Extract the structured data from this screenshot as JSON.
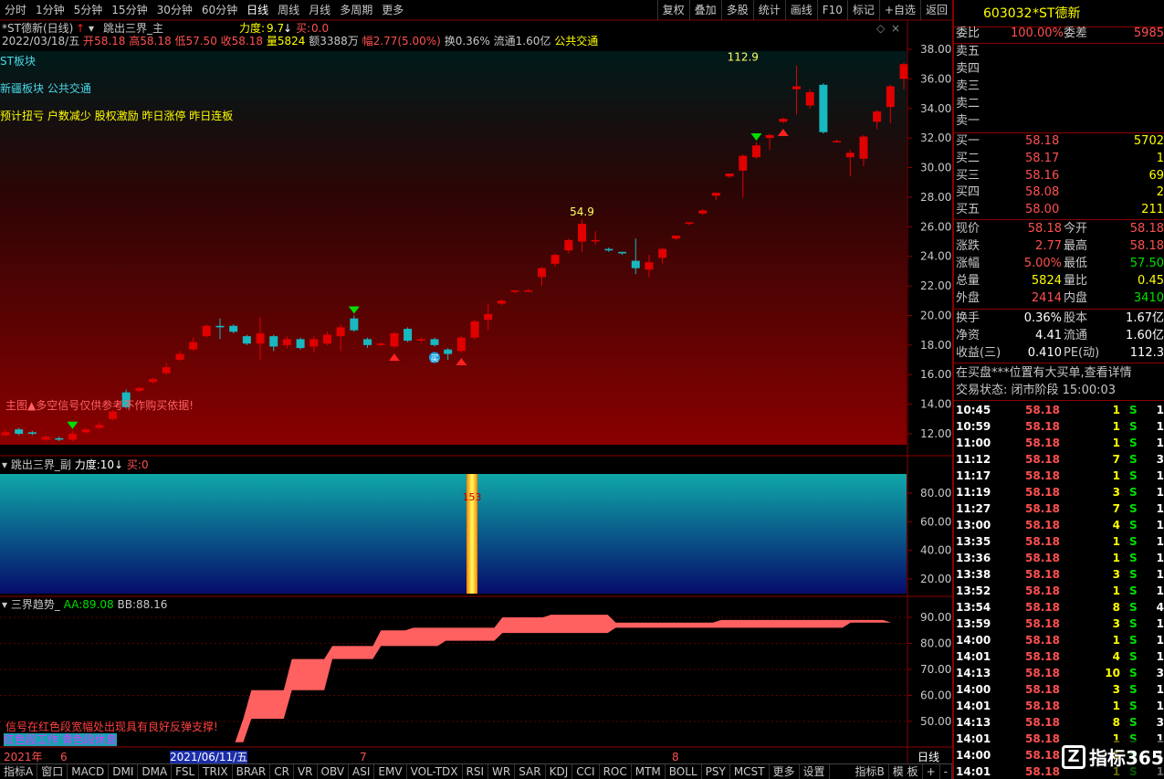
{
  "toolbar": {
    "periods": [
      "分时",
      "1分钟",
      "5分钟",
      "15分钟",
      "30分钟",
      "60分钟",
      "日线",
      "周线",
      "月线",
      "多周期",
      "更多"
    ],
    "active_period": "日线",
    "right": [
      "复权",
      "叠加",
      "多股",
      "统计",
      "画线",
      "F10",
      "标记",
      "+自选",
      "返回"
    ]
  },
  "main_panel": {
    "title": "*ST德新(日线)",
    "indicator": "跳出三界_主",
    "force_label": "力度:",
    "force_value": "9.7",
    "buy_label": "买:",
    "buy_value": "0.0",
    "quote_date": "2022/03/18/五",
    "open_label": "开",
    "open": "58.18",
    "high_label": "高",
    "high": "58.18",
    "low_label": "低",
    "low": "57.50",
    "close_label": "收",
    "close": "58.18",
    "vol_label": "量",
    "vol": "5824",
    "amt_label": "额",
    "amt": "3388万",
    "chg_label": "幅",
    "chg": "2.77(5.00%)",
    "turn_label": "换",
    "turn": "0.36%",
    "float_label": "流通",
    "float": "1.60亿",
    "concept": "公共交通",
    "st_tag": "ST板块",
    "sector_tags": "新疆板块  公共交通",
    "event_tags": "预计扭亏 户数减少 股权激励 昨日涨停 昨日连板",
    "warning": "主图▲多空信号仅供参考不作购买依据!",
    "peak_label_1": "112.9",
    "peak_label_2": "54.9",
    "buy_marker": "买",
    "y_ticks": [
      "38.00",
      "36.00",
      "34.00",
      "32.00",
      "30.00",
      "28.00",
      "26.00",
      "24.00",
      "22.00",
      "20.00",
      "18.00",
      "16.00",
      "14.00",
      "12.00"
    ]
  },
  "sub_panel": {
    "title": "跳出三界_副",
    "force_label": "力度:",
    "force_value": "10",
    "buy_label": "买:",
    "buy_value": "0",
    "bar_label": "153",
    "y_ticks": [
      "80.00",
      "60.00",
      "40.00",
      "20.00"
    ]
  },
  "trend_panel": {
    "title": "三界趋势_",
    "aa_label": "AA:",
    "aa": "89.08",
    "bb_label": "BB:",
    "bb": "88.16",
    "note_1": "信号在红色段宽幅处出现具有良好反弹支撑!",
    "note_2": "红色段工作 青色段休息",
    "y_ticks": [
      "90.00",
      "80.00",
      "70.00",
      "60.00",
      "50.00"
    ]
  },
  "x_axis": {
    "year": "2021年",
    "m6": "6",
    "cursor_date": "2021/06/11/五",
    "m7": "7",
    "m8": "8",
    "period": "日线"
  },
  "bottom_tabs": [
    "指标A",
    "窗口",
    "MACD",
    "DMI",
    "DMA",
    "FSL",
    "TRIX",
    "BRAR",
    "CR",
    "VR",
    "OBV",
    "ASI",
    "EMV",
    "VOL-TDX",
    "RSI",
    "WR",
    "SAR",
    "KDJ",
    "CCI",
    "ROC",
    "MTM",
    "BOLL",
    "PSY",
    "MCST",
    "更多",
    "设置"
  ],
  "bottom_right": [
    "指标B",
    "模 板",
    "+",
    "-"
  ],
  "quote": {
    "code": "603032",
    "name": "*ST德新",
    "weibi_label": "委比",
    "weibi": "100.00%",
    "weicha_label": "委差",
    "weicha": "5985",
    "sells": [
      "卖五",
      "卖四",
      "卖三",
      "卖二",
      "卖一"
    ],
    "buys": [
      {
        "label": "买一",
        "price": "58.18",
        "vol": "5702"
      },
      {
        "label": "买二",
        "price": "58.17",
        "vol": "1"
      },
      {
        "label": "买三",
        "price": "58.16",
        "vol": "69"
      },
      {
        "label": "买四",
        "price": "58.08",
        "vol": "2"
      },
      {
        "label": "买五",
        "price": "58.00",
        "vol": "211"
      }
    ],
    "stats": [
      {
        "l1": "现价",
        "v1": "58.18",
        "l2": "今开",
        "v2": "58.18"
      },
      {
        "l1": "涨跌",
        "v1": "2.77",
        "l2": "最高",
        "v2": "58.18"
      },
      {
        "l1": "涨幅",
        "v1": "5.00%",
        "l2": "最低",
        "v2": "57.50"
      },
      {
        "l1": "总量",
        "v1": "5824",
        "l2": "量比",
        "v2": "0.45"
      },
      {
        "l1": "外盘",
        "v1": "2414",
        "l2": "内盘",
        "v2": "3410"
      }
    ],
    "fin": [
      {
        "l1": "换手",
        "v1": "0.36%",
        "l2": "股本",
        "v2": "1.67亿"
      },
      {
        "l1": "净资",
        "v1": "4.41",
        "l2": "流通",
        "v2": "1.60亿"
      },
      {
        "l1": "收益(三)",
        "v1": "0.410",
        "l2": "PE(动)",
        "v2": "112.3"
      }
    ],
    "notice": "在买盘***位置有大买单,查看详情",
    "trade_state": "交易状态: 闭市阶段 15:00:03",
    "ticks": [
      {
        "t": "10:45",
        "p": "58.18",
        "v": "1",
        "s": "S",
        "x": "1"
      },
      {
        "t": "10:59",
        "p": "58.18",
        "v": "1",
        "s": "S",
        "x": "1"
      },
      {
        "t": "11:00",
        "p": "58.18",
        "v": "1",
        "s": "S",
        "x": "1"
      },
      {
        "t": "11:12",
        "p": "58.18",
        "v": "7",
        "s": "S",
        "x": "3"
      },
      {
        "t": "11:17",
        "p": "58.18",
        "v": "1",
        "s": "S",
        "x": "1"
      },
      {
        "t": "11:19",
        "p": "58.18",
        "v": "3",
        "s": "S",
        "x": "1"
      },
      {
        "t": "11:27",
        "p": "58.18",
        "v": "7",
        "s": "S",
        "x": "1"
      },
      {
        "t": "13:00",
        "p": "58.18",
        "v": "4",
        "s": "S",
        "x": "1"
      },
      {
        "t": "13:35",
        "p": "58.18",
        "v": "1",
        "s": "S",
        "x": "1"
      },
      {
        "t": "13:36",
        "p": "58.18",
        "v": "1",
        "s": "S",
        "x": "1"
      },
      {
        "t": "13:38",
        "p": "58.18",
        "v": "3",
        "s": "S",
        "x": "1"
      },
      {
        "t": "13:52",
        "p": "58.18",
        "v": "1",
        "s": "S",
        "x": "1"
      },
      {
        "t": "13:54",
        "p": "58.18",
        "v": "8",
        "s": "S",
        "x": "4"
      },
      {
        "t": "13:59",
        "p": "58.18",
        "v": "3",
        "s": "S",
        "x": "1"
      },
      {
        "t": "14:00",
        "p": "58.18",
        "v": "1",
        "s": "S",
        "x": "1"
      },
      {
        "t": "14:01",
        "p": "58.18",
        "v": "4",
        "s": "S",
        "x": "1"
      },
      {
        "t": "14:13",
        "p": "58.18",
        "v": "10",
        "s": "S",
        "x": "3"
      },
      {
        "t": "14:00",
        "p": "58.18",
        "v": "3",
        "s": "S",
        "x": "1"
      },
      {
        "t": "14:01",
        "p": "58.18",
        "v": "1",
        "s": "S",
        "x": "1"
      },
      {
        "t": "14:13",
        "p": "58.18",
        "v": "8",
        "s": "S",
        "x": "3"
      },
      {
        "t": "14:01",
        "p": "58.18",
        "v": "1",
        "s": "S",
        "x": "1"
      },
      {
        "t": "14:00",
        "p": "58.18",
        "v": "1",
        "s": "S",
        "x": "1"
      },
      {
        "t": "14:01",
        "p": "58.18",
        "v": "1",
        "s": "S",
        "x": "1"
      }
    ],
    "watermark": "指标365"
  },
  "colors": {
    "up": "#e00000",
    "down": "#18b8c0",
    "buy_signal": "#ff2020",
    "sell_signal": "#00e000",
    "trend_fill": "#ff6060"
  },
  "chart_data": [
    {
      "type": "candlestick",
      "title": "*ST德新(日线)",
      "y_axis_ticks": [
        12,
        14,
        16,
        18,
        20,
        22,
        24,
        26,
        28,
        30,
        32,
        34,
        36,
        38
      ],
      "candles": [
        [
          11.9,
          12.1,
          11.8,
          12.3
        ],
        [
          12.3,
          12.0,
          11.9,
          12.4
        ],
        [
          12.1,
          12.0,
          11.9,
          12.2
        ],
        [
          11.6,
          11.8,
          11.5,
          11.9
        ],
        [
          11.7,
          11.6,
          11.5,
          11.8
        ],
        [
          11.6,
          12.0,
          11.5,
          12.2
        ],
        [
          12.1,
          12.3,
          12.0,
          12.4
        ],
        [
          12.4,
          12.6,
          12.3,
          12.8
        ],
        [
          13.0,
          13.5,
          12.9,
          13.6
        ],
        [
          14.8,
          13.8,
          13.7,
          15.0
        ],
        [
          14.9,
          15.1,
          14.8,
          15.2
        ],
        [
          15.5,
          15.7,
          15.4,
          15.8
        ],
        [
          16.1,
          16.5,
          16.0,
          16.8
        ],
        [
          17.0,
          17.4,
          16.9,
          17.6
        ],
        [
          17.7,
          18.2,
          17.6,
          18.5
        ],
        [
          18.6,
          19.3,
          18.5,
          19.4
        ],
        [
          19.3,
          19.2,
          18.4,
          19.8
        ],
        [
          19.3,
          18.9,
          18.8,
          19.4
        ],
        [
          18.6,
          18.1,
          18.0,
          18.7
        ],
        [
          18.1,
          18.8,
          17.0,
          19.9
        ],
        [
          18.6,
          17.9,
          17.6,
          18.7
        ],
        [
          18.0,
          18.4,
          17.8,
          18.6
        ],
        [
          18.4,
          17.8,
          17.7,
          18.5
        ],
        [
          17.9,
          18.4,
          17.5,
          18.6
        ],
        [
          18.1,
          18.7,
          18.0,
          18.9
        ],
        [
          18.6,
          19.2,
          17.6,
          19.4
        ],
        [
          19.8,
          19.0,
          18.9,
          20.0
        ],
        [
          18.4,
          18.0,
          17.8,
          18.5
        ],
        [
          18.0,
          18.1,
          17.9,
          18.2
        ],
        [
          17.9,
          18.8,
          17.8,
          18.9
        ],
        [
          19.1,
          18.3,
          18.2,
          19.2
        ],
        [
          18.3,
          18.4,
          18.2,
          18.5
        ],
        [
          18.4,
          18.0,
          17.9,
          18.5
        ],
        [
          17.7,
          17.4,
          17.0,
          17.8
        ],
        [
          17.6,
          18.5,
          17.5,
          18.6
        ],
        [
          18.5,
          19.6,
          18.4,
          19.7
        ],
        [
          19.7,
          20.1,
          19.0,
          20.8
        ],
        [
          20.8,
          21.0,
          20.7,
          21.1
        ],
        [
          21.6,
          21.7,
          21.5,
          21.7
        ],
        [
          21.7,
          21.7,
          21.6,
          21.8
        ],
        [
          22.6,
          23.2,
          22.0,
          23.3
        ],
        [
          23.5,
          24.1,
          23.3,
          24.2
        ],
        [
          24.4,
          25.1,
          24.2,
          25.2
        ],
        [
          25.0,
          26.2,
          24.3,
          26.5
        ],
        [
          25.1,
          25.1,
          24.8,
          25.7
        ],
        [
          24.5,
          24.4,
          24.3,
          24.6
        ],
        [
          24.3,
          24.2,
          24.1,
          24.3
        ],
        [
          23.7,
          23.2,
          22.8,
          25.2
        ],
        [
          23.1,
          23.6,
          22.6,
          24.1
        ],
        [
          23.9,
          24.5,
          23.5,
          24.6
        ],
        [
          25.2,
          25.4,
          25.1,
          25.4
        ],
        [
          26.2,
          26.3,
          26.1,
          26.3
        ],
        [
          26.9,
          27.1,
          26.8,
          27.2
        ],
        [
          28.1,
          28.3,
          27.8,
          28.3
        ],
        [
          29.4,
          29.6,
          29.3,
          29.6
        ],
        [
          29.8,
          30.8,
          28.0,
          30.9
        ],
        [
          30.7,
          31.5,
          30.6,
          31.7
        ],
        [
          32.0,
          32.2,
          31.2,
          32.3
        ],
        [
          33.1,
          33.3,
          33.0,
          33.4
        ],
        [
          35.3,
          35.5,
          33.6,
          36.9
        ],
        [
          34.2,
          35.1,
          34.0,
          35.3
        ],
        [
          35.6,
          32.4,
          32.3,
          35.7
        ],
        [
          31.8,
          31.8,
          31.7,
          31.9
        ],
        [
          30.7,
          31.0,
          29.4,
          31.2
        ],
        [
          30.6,
          32.1,
          30.1,
          32.2
        ],
        [
          33.1,
          33.8,
          32.6,
          33.9
        ],
        [
          34.1,
          35.5,
          33.0,
          35.6
        ],
        [
          36.0,
          37.0,
          35.3,
          37.1
        ]
      ],
      "annotations": [
        "112.9",
        "54.9"
      ]
    },
    {
      "type": "bar",
      "title": "跳出三界_副",
      "y_axis_ticks": [
        20,
        40,
        60,
        80
      ],
      "values": [
        153
      ]
    },
    {
      "type": "area",
      "title": "三界趋势_",
      "series": [
        {
          "name": "AA",
          "last": 89.08
        },
        {
          "name": "BB",
          "last": 88.16
        }
      ],
      "y_axis_ticks": [
        50,
        60,
        70,
        80,
        90
      ],
      "upper": [
        42,
        42,
        42,
        42,
        42,
        42,
        42,
        42,
        42,
        42,
        42,
        42,
        51,
        62,
        62,
        62,
        62,
        62,
        74,
        74,
        74,
        74,
        74,
        79,
        79,
        79,
        79,
        79,
        79,
        85,
        85,
        85,
        85,
        86,
        86,
        86,
        86,
        86,
        86,
        86,
        86,
        86,
        86,
        86,
        90,
        90,
        90,
        90,
        90,
        90,
        91,
        91,
        91,
        91,
        91,
        91,
        91,
        91,
        88,
        88,
        88,
        88,
        88,
        88,
        88,
        88,
        88,
        88,
        88,
        88,
        88,
        89,
        89,
        89,
        89,
        89,
        89,
        89,
        89,
        89,
        89,
        89,
        89,
        89,
        89,
        89,
        89,
        89,
        89,
        89,
        89,
        89,
        88,
        88
      ],
      "lower": [
        42,
        42,
        42,
        42,
        42,
        42,
        42,
        42,
        42,
        42,
        42,
        42,
        42,
        51,
        51,
        51,
        51,
        51,
        62,
        62,
        62,
        62,
        62,
        74,
        74,
        74,
        74,
        74,
        74,
        79,
        79,
        79,
        79,
        79,
        79,
        79,
        79,
        81,
        81,
        81,
        81,
        81,
        81,
        81,
        84,
        84,
        84,
        84,
        84,
        84,
        84,
        84,
        84,
        84,
        84,
        84,
        84,
        84,
        86,
        86,
        86,
        86,
        86,
        86,
        86,
        86,
        86,
        86,
        86,
        86,
        86,
        86,
        86,
        86,
        86,
        86,
        86,
        86,
        86,
        86,
        86,
        86,
        86,
        86,
        86,
        86,
        86,
        88,
        88,
        88,
        88,
        88,
        88,
        88
      ]
    }
  ]
}
